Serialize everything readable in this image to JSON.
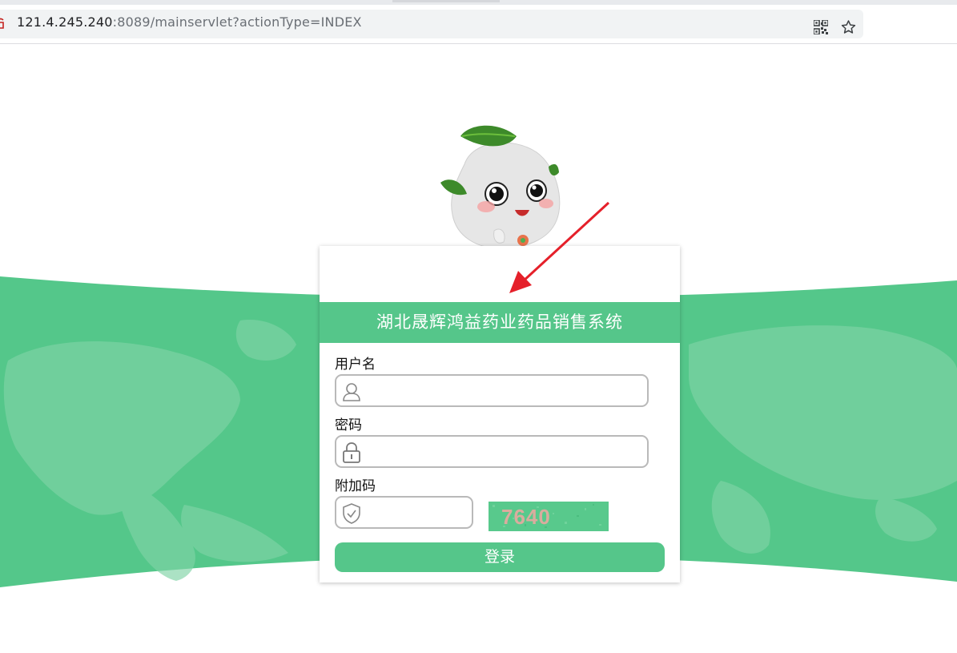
{
  "browser": {
    "url_host": "121.4.245.240",
    "url_rest": ":8089/mainservlet?actionType=INDEX",
    "icons": [
      "lock-icon",
      "qr-code-icon",
      "star-icon"
    ]
  },
  "login": {
    "title": "湖北晟辉鸿益药业药品销售系统",
    "username_label": "用户名",
    "username_value": "",
    "password_label": "密码",
    "password_value": "",
    "captcha_label": "附加码",
    "captcha_value": "",
    "captcha_image_text": "7640",
    "submit_label": "登录"
  },
  "colors": {
    "accent": "#55c68a",
    "band": "#54c78a",
    "arrow": "#e5202a"
  }
}
